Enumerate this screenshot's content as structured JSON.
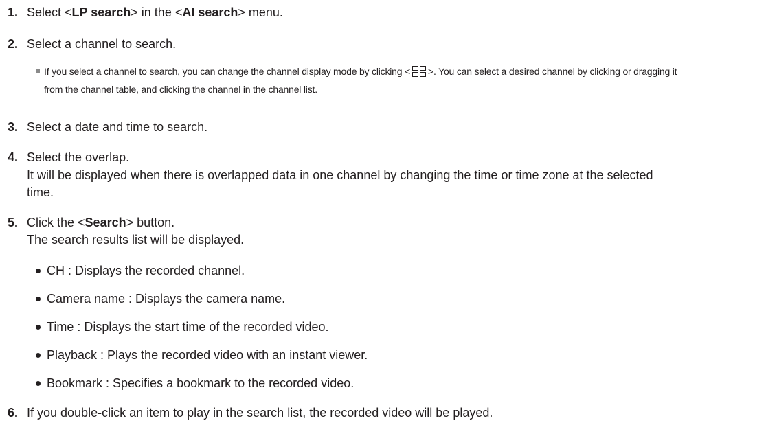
{
  "steps": [
    {
      "num": "1.",
      "pre": "Select <",
      "bold1": "LP search",
      "mid": "> in the <",
      "bold2": "AI search",
      "post": "> menu."
    },
    {
      "num": "2.",
      "text": "Select a channel to search."
    },
    {
      "num": "3.",
      "text": "Select a date and time to search."
    },
    {
      "num": "4.",
      "text": "Select the overlap.",
      "detail_1": "It will be displayed when there is overlapped data in one channel by changing the time or time zone at the selected",
      "detail_2": "time."
    },
    {
      "num": "5.",
      "pre": "Click the <",
      "bold": "Search",
      "post": "> button.",
      "detail": "The search results list will be displayed."
    },
    {
      "num": "6.",
      "text": "If you double-click an item to play in the search list, the recorded video will be played."
    }
  ],
  "note": {
    "icon": "grid-layout-icon",
    "pre": "If you select a channel to search, you can change the channel display mode by clicking <",
    "post": ">. You can select a desired channel by clicking or dragging it",
    "line2": "from the channel table, and clicking the channel in the channel list."
  },
  "results_fields": [
    "CH : Displays the recorded channel.",
    "Camera name : Displays the camera name.",
    "Time : Displays the start time of the recorded video.",
    "Playback : Plays the recorded video with an instant viewer.",
    "Bookmark : Specifies a bookmark to the recorded video."
  ]
}
